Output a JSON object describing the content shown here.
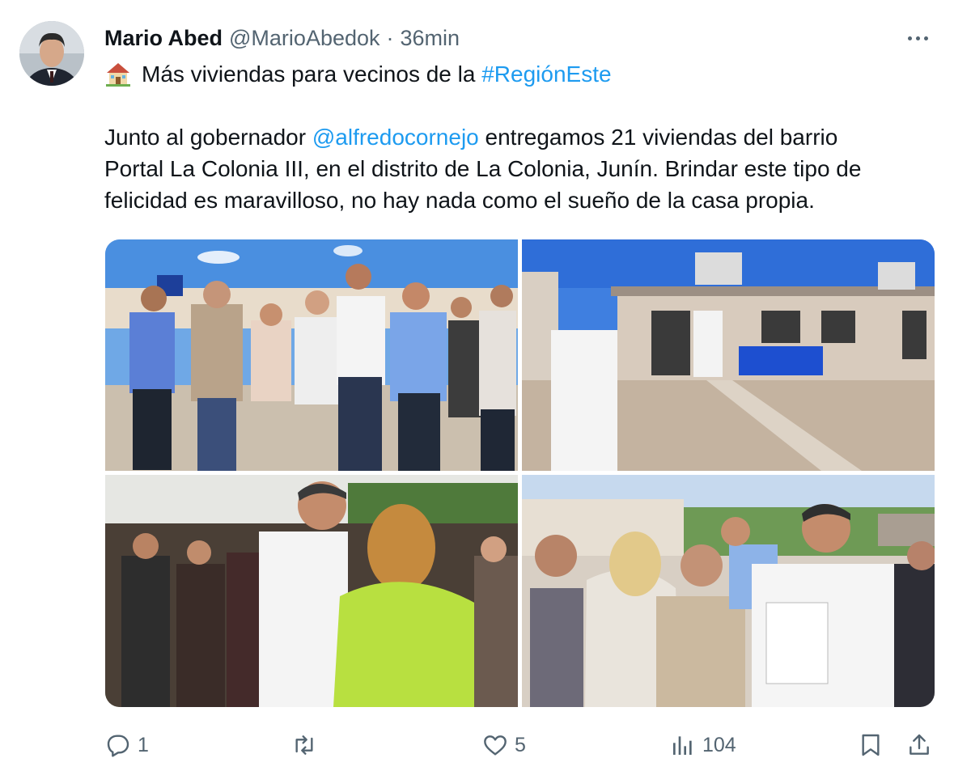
{
  "tweet": {
    "author_name": "Mario Abed",
    "author_handle": "@MarioAbedok",
    "separator": "·",
    "time": "36min",
    "line1_text": "Más viviendas para vecinos de la ",
    "line1_hashtag": "#RegiónEste",
    "body_row1_pre": "Junto al gobernador ",
    "body_row1_mention": "@alfredocornejo",
    "body_row1_post": " entregamos 21 viviendas del barrio",
    "body_row2": "Portal La Colonia III, en el distrito de La Colonia, Junín. Brindar este tipo de",
    "body_row3": "felicidad es maravilloso, no hay nada como el sueño de la casa propia."
  },
  "actions": {
    "reply_count": "1",
    "retweet_count": "",
    "like_count": "5",
    "views_count": "104"
  },
  "icons": {
    "house": "house-emoji-icon",
    "more": "more-dots-icon",
    "reply": "reply-icon",
    "retweet": "retweet-icon",
    "like": "heart-icon",
    "views": "views-chart-icon",
    "bookmark": "bookmark-icon",
    "share": "share-icon"
  },
  "colors": {
    "link": "#1d9bf0",
    "secondary_text": "#536471",
    "primary_text": "#0f1419"
  }
}
